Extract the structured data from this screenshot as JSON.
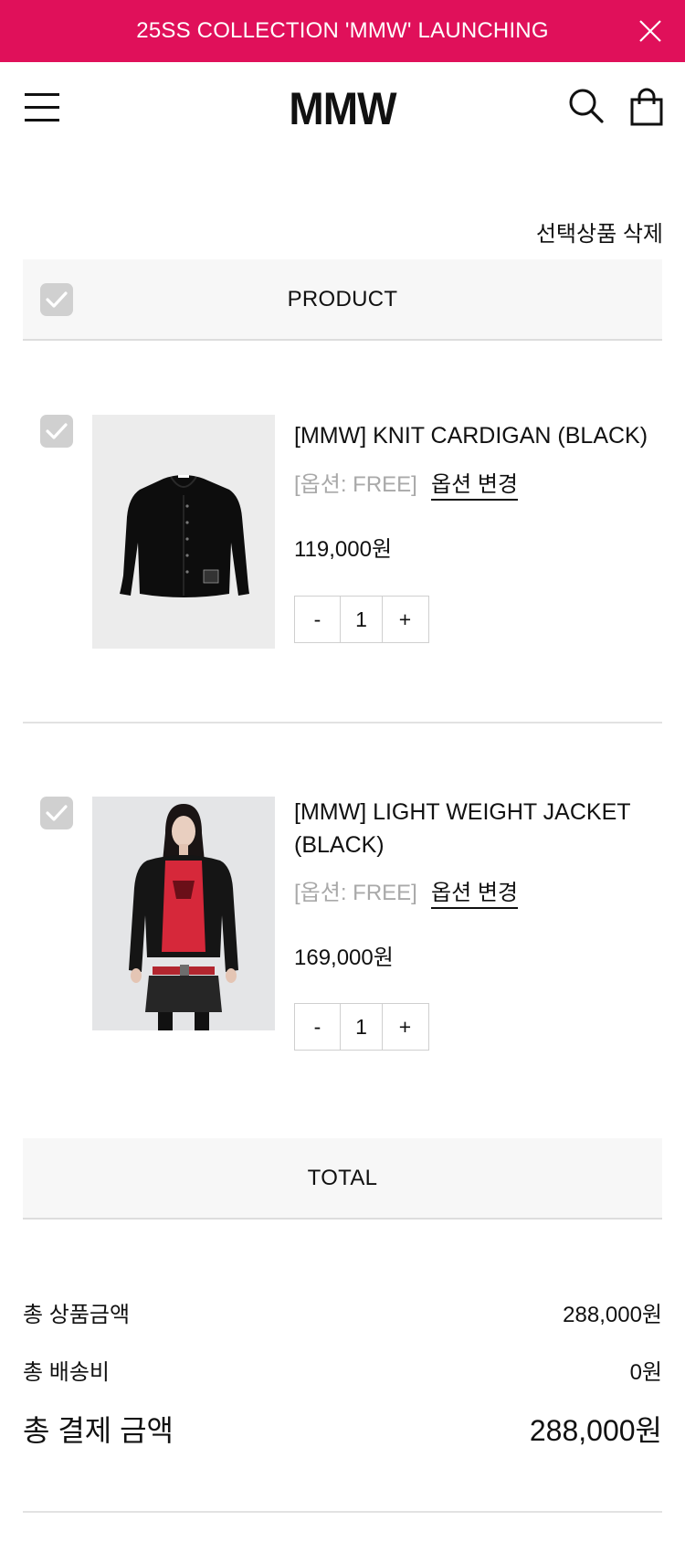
{
  "banner": {
    "text": "25SS COLLECTION 'MMW' LAUNCHING",
    "close_icon": "close-icon",
    "color": "#e0105a"
  },
  "header": {
    "logo": "MMW",
    "menu_icon": "hamburger-menu-icon",
    "search_icon": "search-icon",
    "cart_icon": "shopping-bag-icon"
  },
  "cart": {
    "delete_selected_label": "선택상품 삭제",
    "product_header": "PRODUCT",
    "items": [
      {
        "name": "[MMW] KNIT CARDIGAN (BLACK)",
        "option": "[옵션: FREE]",
        "option_change_label": "옵션 변경",
        "price": "119,000원",
        "quantity": "1",
        "minus_label": "-",
        "plus_label": "+",
        "checked": true
      },
      {
        "name": "[MMW] LIGHT WEIGHT JACKET (BLACK)",
        "option": "[옵션: FREE]",
        "option_change_label": "옵션 변경",
        "price": "169,000원",
        "quantity": "1",
        "minus_label": "-",
        "plus_label": "+",
        "checked": true
      }
    ]
  },
  "total": {
    "header": "TOTAL",
    "product_amount_label": "총 상품금액",
    "product_amount_value": "288,000원",
    "shipping_label": "총 배송비",
    "shipping_value": "0원",
    "grand_total_label": "총 결제 금액",
    "grand_total_value": "288,000원"
  }
}
